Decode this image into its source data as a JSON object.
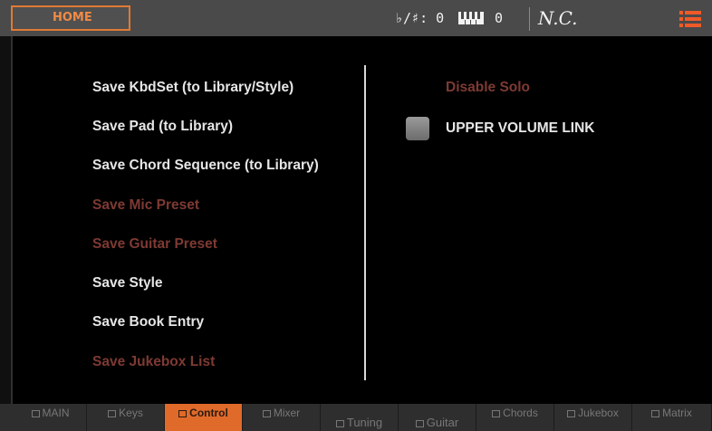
{
  "header": {
    "home_label": "HOME",
    "transpose_label": "♭/♯: 0",
    "octave_value": "0",
    "chord_name": "N.C.",
    "menu_icon": "list-menu-icon",
    "accent_color": "#e07a33"
  },
  "menu": {
    "left_items": [
      {
        "label": "Save KbdSet (to Library/Style)",
        "enabled": true
      },
      {
        "label": "Save Pad (to Library)",
        "enabled": true
      },
      {
        "label": "Save Chord Sequence (to Library)",
        "enabled": true
      },
      {
        "label": "Save Mic Preset",
        "enabled": false
      },
      {
        "label": "Save Guitar Preset",
        "enabled": false
      },
      {
        "label": "Save Style",
        "enabled": true
      },
      {
        "label": "Save Book Entry",
        "enabled": true
      },
      {
        "label": "Save Jukebox List",
        "enabled": false
      }
    ],
    "disable_solo_label": "Disable Solo",
    "upper_volume_link_label": "UPPER VOLUME LINK",
    "upper_volume_link_checked": false,
    "disabled_color": "#7e3a33"
  },
  "tabs": [
    {
      "label": "MAIN"
    },
    {
      "label": "Keys"
    },
    {
      "label": "Control"
    },
    {
      "label": "Mixer"
    },
    {
      "label": "",
      "sub": "Tuning"
    },
    {
      "label": "",
      "sub": "Guitar"
    },
    {
      "label": "Chords"
    },
    {
      "label": "Jukebox"
    },
    {
      "label": "Matrix"
    }
  ]
}
